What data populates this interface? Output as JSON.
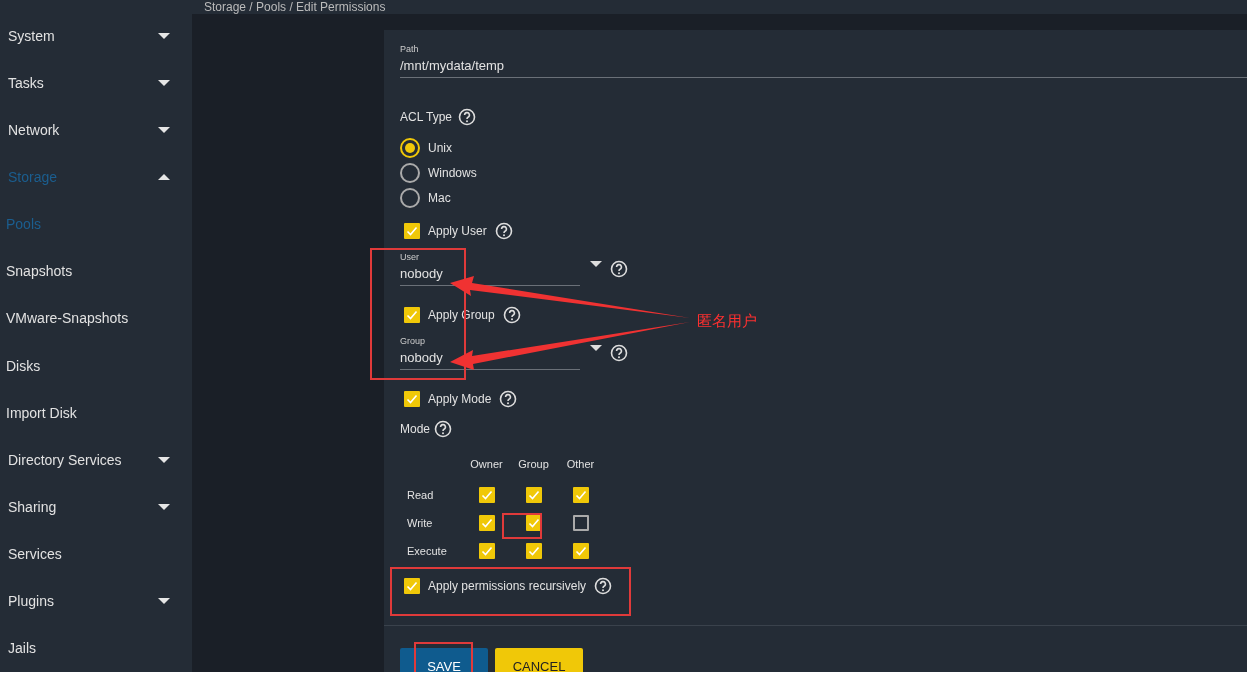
{
  "breadcrumb": "Storage / Pools / Edit Permissions",
  "sidebar": {
    "items": [
      {
        "label": "System",
        "expanded": false,
        "selected": false
      },
      {
        "label": "Tasks",
        "expanded": false,
        "selected": false
      },
      {
        "label": "Network",
        "expanded": false,
        "selected": false
      },
      {
        "label": "Storage",
        "expanded": true,
        "selected": true,
        "children": [
          {
            "label": "Pools",
            "selected": true
          },
          {
            "label": "Snapshots",
            "selected": false
          },
          {
            "label": "VMware-Snapshots",
            "selected": false
          },
          {
            "label": "Disks",
            "selected": false
          },
          {
            "label": "Import Disk",
            "selected": false
          }
        ]
      },
      {
        "label": "Directory Services",
        "expanded": false,
        "selected": false
      },
      {
        "label": "Sharing",
        "expanded": false,
        "selected": false
      },
      {
        "label": "Services",
        "selected": false
      },
      {
        "label": "Plugins",
        "expanded": false,
        "selected": false
      },
      {
        "label": "Jails",
        "selected": false
      }
    ]
  },
  "form": {
    "path": {
      "label": "Path",
      "value": "/mnt/mydata/temp"
    },
    "acl_type": {
      "label": "ACL Type",
      "options": [
        {
          "label": "Unix",
          "selected": true
        },
        {
          "label": "Windows",
          "selected": false
        },
        {
          "label": "Mac",
          "selected": false
        }
      ]
    },
    "apply_user": {
      "label": "Apply User",
      "checked": true
    },
    "user": {
      "label": "User",
      "value": "nobody"
    },
    "apply_group": {
      "label": "Apply Group",
      "checked": true
    },
    "group": {
      "label": "Group",
      "value": "nobody"
    },
    "apply_mode": {
      "label": "Apply Mode",
      "checked": true
    },
    "mode": {
      "label": "Mode",
      "columns": [
        "Owner",
        "Group",
        "Other"
      ],
      "rows": [
        {
          "label": "Read",
          "checks": [
            true,
            true,
            true
          ]
        },
        {
          "label": "Write",
          "checks": [
            true,
            true,
            false
          ]
        },
        {
          "label": "Execute",
          "checks": [
            true,
            true,
            true
          ]
        }
      ]
    },
    "recursive": {
      "label": "Apply permissions recursively",
      "checked": true
    },
    "buttons": [
      {
        "label": "SAVE",
        "kind": "primary"
      },
      {
        "label": "CANCEL",
        "kind": "secondary"
      }
    ]
  },
  "annotation": {
    "label": "匿名用户"
  }
}
